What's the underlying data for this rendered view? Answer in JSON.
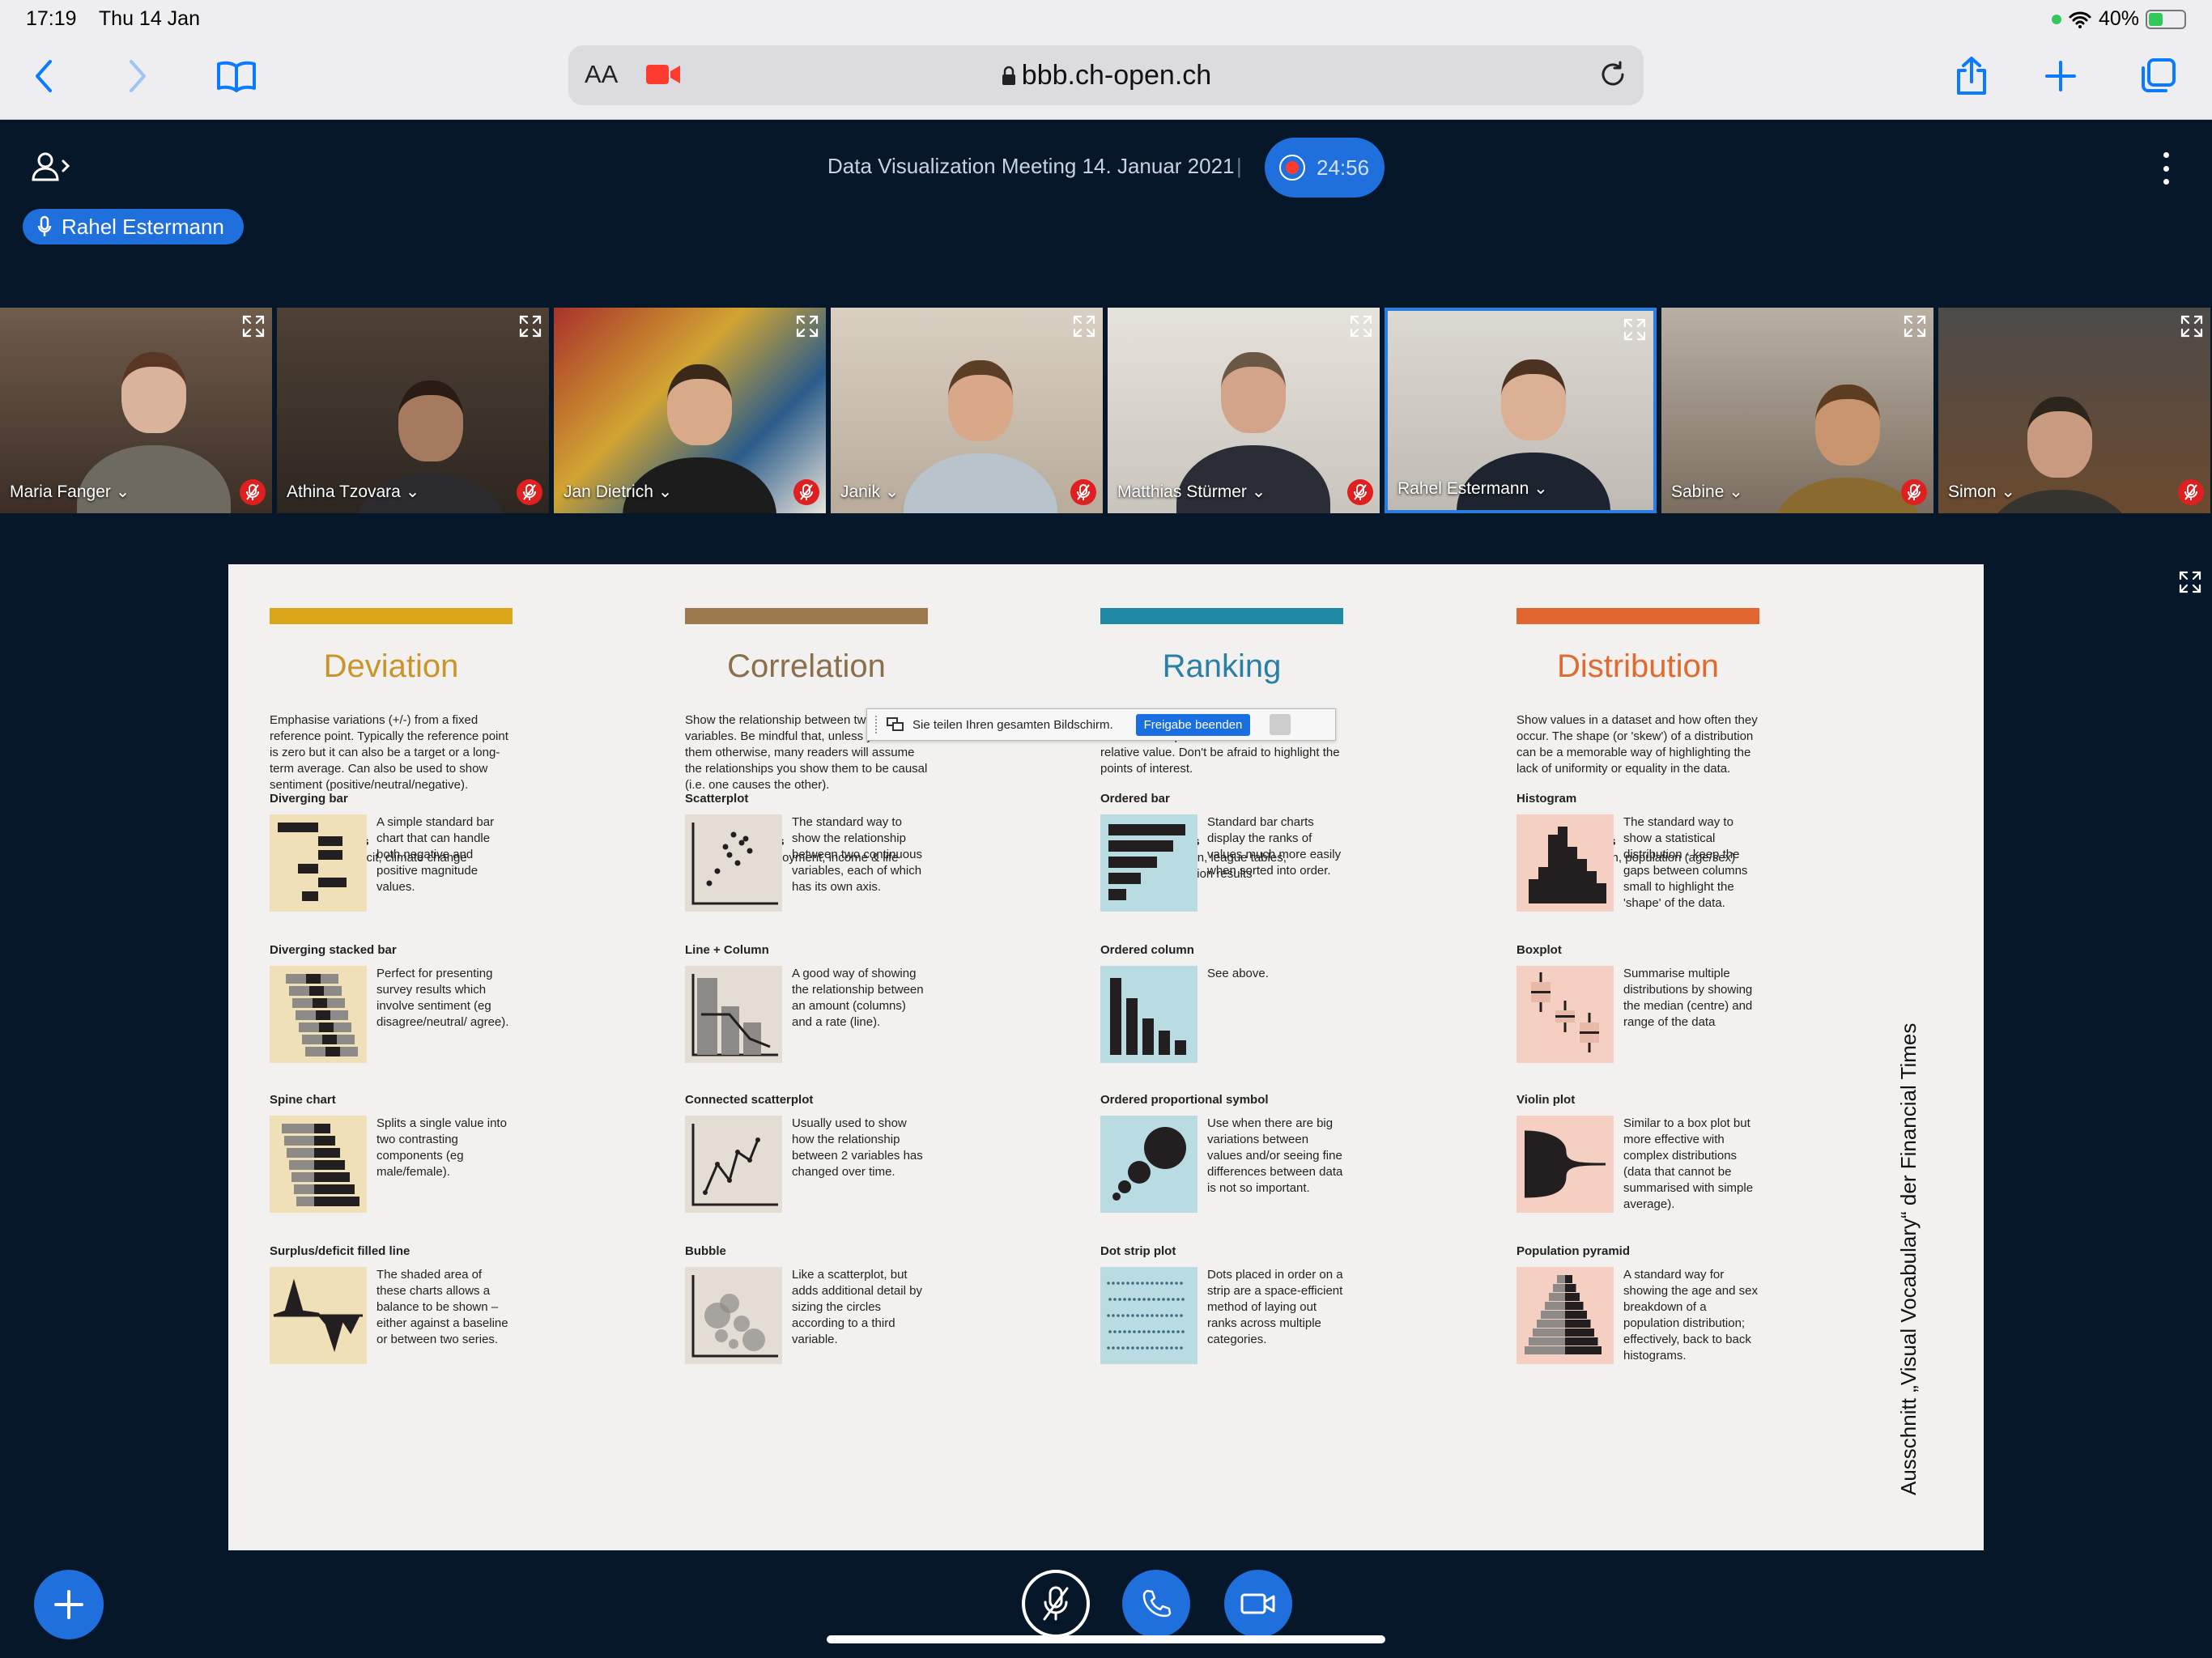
{
  "status": {
    "time": "17:19",
    "date": "Thu 14 Jan",
    "battery": "40%",
    "battery_level": 0.4
  },
  "browser": {
    "text_size_label": "AA",
    "url": "bbb.ch-open.ch"
  },
  "meeting": {
    "title": "Data Visualization Meeting 14. Januar 2021",
    "separator": "|",
    "recording_time": "24:56",
    "talker": "Rahel Estermann"
  },
  "participants": [
    {
      "name": "Maria Fanger",
      "muted": true
    },
    {
      "name": "Athina Tzovara",
      "muted": true
    },
    {
      "name": "Jan Dietrich",
      "muted": true
    },
    {
      "name": "Janik",
      "muted": true
    },
    {
      "name": "Matthias Stürmer",
      "muted": true
    },
    {
      "name": "Rahel Estermann",
      "muted": false,
      "active": true
    },
    {
      "name": "Sabine",
      "muted": true
    },
    {
      "name": "Simon",
      "muted": true
    }
  ],
  "share_bar": {
    "text": "Sie teilen Ihren gesamten Bildschirm.",
    "stop_label": "Freigabe beenden"
  },
  "slide": {
    "side_credit": "Ausschnitt „Visual Vocabulary“ der Financial Times",
    "columns": [
      {
        "title": "Deviation",
        "color": "#d9a617",
        "title_color": "#c9952a",
        "desc": "Emphasise variations (+/-) from a fixed reference point. Typically the reference point is zero but it can also be a target or a long-term average. Can also be used to show sentiment (positive/neutral/negative).",
        "uses_label": "Example FT uses",
        "uses": "Trade surplus/deficit, climate change",
        "charts": [
          {
            "title": "Diverging bar",
            "desc": "A simple standard bar chart that can handle both negative and positive magnitude values."
          },
          {
            "title": "Diverging stacked bar",
            "desc": "Perfect for presenting survey results which involve sentiment (eg disagree/neutral/ agree)."
          },
          {
            "title": "Spine chart",
            "desc": "Splits a single value into two contrasting components (eg male/female)."
          },
          {
            "title": "Surplus/deficit filled line",
            "desc": "The shaded area of these charts allows a balance to be shown – either against a baseline or between two series."
          }
        ]
      },
      {
        "title": "Correlation",
        "color": "#9c7a4e",
        "title_color": "#8a6f4e",
        "desc": "Show the relationship between two or more variables. Be mindful that, unless you tell them otherwise, many readers will assume the relationships you show them to be causal (i.e. one causes the other).",
        "uses_label": "Example FT uses",
        "uses": "Inflation & unemployment, income & life expectancy",
        "charts": [
          {
            "title": "Scatterplot",
            "desc": "The standard way to show the relationship between two continuous variables, each of which has its own axis."
          },
          {
            "title": "Line + Column",
            "desc": "A good way of showing the relationship between an amount (columns) and a rate (line)."
          },
          {
            "title": "Connected scatterplot",
            "desc": "Usually used to show how the relationship between 2 variables has changed over time."
          },
          {
            "title": "Bubble",
            "desc": "Like a scatterplot, but adds additional detail by sizing the circles according to a third variable."
          }
        ]
      },
      {
        "title": "Ranking",
        "color": "#1f8aa6",
        "title_color": "#2a7fa6",
        "desc": "Use where an item's position in an ordered list is more important than its absolute or relative value. Don't be afraid to highlight the points of interest.",
        "uses_label": "Example FT uses",
        "uses": "Wealth, deprivation, league tables, constituency election results",
        "charts": [
          {
            "title": "Ordered bar",
            "desc": "Standard bar charts display the ranks of values much more easily when sorted into order."
          },
          {
            "title": "Ordered column",
            "desc": "See above."
          },
          {
            "title": "Ordered proportional symbol",
            "desc": "Use when there are big variations between values and/or seeing fine differences between data is not so important."
          },
          {
            "title": "Dot strip plot",
            "desc": "Dots placed in order on a strip are a space-efficient method of laying out ranks across multiple categories."
          }
        ]
      },
      {
        "title": "Distribution",
        "color": "#e2662f",
        "title_color": "#e06a2f",
        "desc": "Show values in a dataset and how often they occur. The shape (or 'skew') of a distribution can be a memorable way of highlighting the lack of uniformity or equality in the data.",
        "uses_label": "Example FT uses",
        "uses": "Income distribution, population (age/sex) distribution",
        "charts": [
          {
            "title": "Histogram",
            "desc": "The standard way to show a statistical distribution - keep the gaps between columns small to highlight the 'shape' of the data."
          },
          {
            "title": "Boxplot",
            "desc": "Summarise multiple distributions by showing the median (centre) and range of the data"
          },
          {
            "title": "Violin plot",
            "desc": "Similar to a box plot but more effective with complex distributions (data that cannot be summarised with simple average)."
          },
          {
            "title": "Population pyramid",
            "desc": "A standard way for showing the age and sex breakdown of a population distribution; effectively, back to back histograms."
          }
        ]
      }
    ]
  }
}
